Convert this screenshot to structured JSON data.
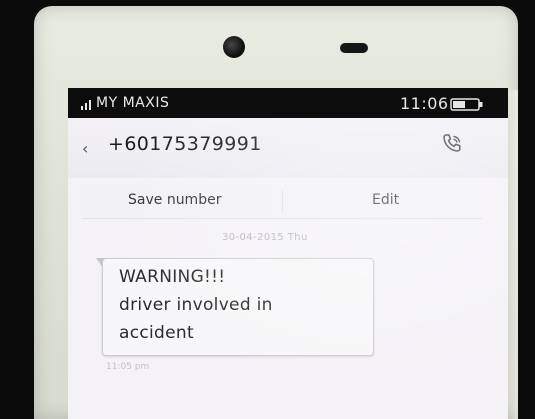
{
  "status_bar": {
    "carrier": "MY MAXIS",
    "time": "11:06",
    "signal_icon": "signal-bars-icon",
    "battery_icon": "battery-icon"
  },
  "header": {
    "back_icon": "chevron-left-icon",
    "phone_number": "+60175379991",
    "call_icon": "phone-call-icon"
  },
  "actions": {
    "save_number": "Save number",
    "edit": "Edit"
  },
  "conversation": {
    "date": "30-04-2015 Thu",
    "messages": [
      {
        "lines": [
          "WARNING!!!",
          "driver involved in",
          "accident"
        ],
        "time": "11:05 pm"
      }
    ]
  },
  "colors": {
    "statusbar_bg": "#0d0d0d",
    "screen_bg": "#f4f2f6",
    "bubble_border": "#cfcbd4"
  }
}
